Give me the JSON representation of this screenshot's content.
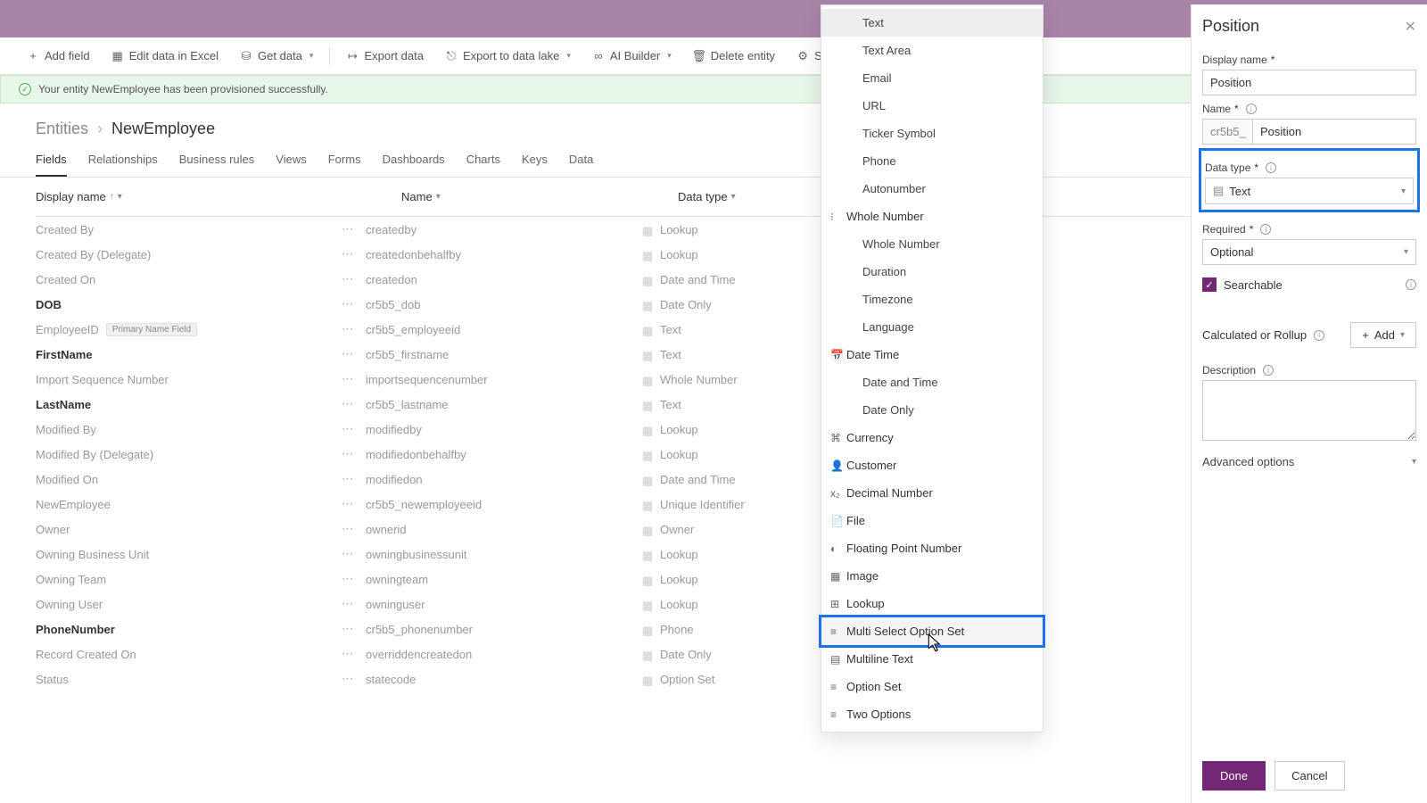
{
  "toolbar": {
    "add_field": "Add field",
    "edit_excel": "Edit data in Excel",
    "get_data": "Get data",
    "export_data": "Export data",
    "export_lake": "Export to data lake",
    "ai_builder": "AI Builder",
    "delete_entity": "Delete entity",
    "settings": "Settings"
  },
  "success_msg": "Your entity NewEmployee has been provisioned successfully.",
  "breadcrumb": {
    "parent": "Entities",
    "current": "NewEmployee"
  },
  "tabs": [
    "Fields",
    "Relationships",
    "Business rules",
    "Views",
    "Forms",
    "Dashboards",
    "Charts",
    "Keys",
    "Data"
  ],
  "columns": {
    "display": "Display name",
    "name": "Name",
    "type": "Data type"
  },
  "rows": [
    {
      "display": "Created By",
      "name": "createdby",
      "type": "Lookup",
      "bold": false
    },
    {
      "display": "Created By (Delegate)",
      "name": "createdonbehalfby",
      "type": "Lookup",
      "bold": false
    },
    {
      "display": "Created On",
      "name": "createdon",
      "type": "Date and Time",
      "bold": false
    },
    {
      "display": "DOB",
      "name": "cr5b5_dob",
      "type": "Date Only",
      "bold": true
    },
    {
      "display": "EmployeeID",
      "name": "cr5b5_employeeid",
      "type": "Text",
      "bold": false,
      "badge": "Primary Name Field"
    },
    {
      "display": "FirstName",
      "name": "cr5b5_firstname",
      "type": "Text",
      "bold": true
    },
    {
      "display": "Import Sequence Number",
      "name": "importsequencenumber",
      "type": "Whole Number",
      "bold": false
    },
    {
      "display": "LastName",
      "name": "cr5b5_lastname",
      "type": "Text",
      "bold": true
    },
    {
      "display": "Modified By",
      "name": "modifiedby",
      "type": "Lookup",
      "bold": false
    },
    {
      "display": "Modified By (Delegate)",
      "name": "modifiedonbehalfby",
      "type": "Lookup",
      "bold": false
    },
    {
      "display": "Modified On",
      "name": "modifiedon",
      "type": "Date and Time",
      "bold": false
    },
    {
      "display": "NewEmployee",
      "name": "cr5b5_newemployeeid",
      "type": "Unique Identifier",
      "bold": false
    },
    {
      "display": "Owner",
      "name": "ownerid",
      "type": "Owner",
      "bold": false
    },
    {
      "display": "Owning Business Unit",
      "name": "owningbusinessunit",
      "type": "Lookup",
      "bold": false
    },
    {
      "display": "Owning Team",
      "name": "owningteam",
      "type": "Lookup",
      "bold": false
    },
    {
      "display": "Owning User",
      "name": "owninguser",
      "type": "Lookup",
      "bold": false
    },
    {
      "display": "PhoneNumber",
      "name": "cr5b5_phonenumber",
      "type": "Phone",
      "bold": true
    },
    {
      "display": "Record Created On",
      "name": "overriddencreatedon",
      "type": "Date Only",
      "bold": false
    },
    {
      "display": "Status",
      "name": "statecode",
      "type": "Option Set",
      "bold": false
    }
  ],
  "dropdown": {
    "text_items": [
      "Text",
      "Text Area",
      "Email",
      "URL",
      "Ticker Symbol",
      "Phone",
      "Autonumber"
    ],
    "groups": [
      {
        "label": "Whole Number",
        "icon": "123",
        "items": [
          "Whole Number",
          "Duration",
          "Timezone",
          "Language"
        ]
      },
      {
        "label": "Date Time",
        "icon": "cal",
        "items": [
          "Date and Time",
          "Date Only"
        ]
      }
    ],
    "simple": [
      {
        "label": "Currency",
        "icon": "cur"
      },
      {
        "label": "Customer",
        "icon": "cust"
      },
      {
        "label": "Decimal Number",
        "icon": "dec"
      },
      {
        "label": "File",
        "icon": "file"
      },
      {
        "label": "Floating Point Number",
        "icon": "float"
      },
      {
        "label": "Image",
        "icon": "img"
      },
      {
        "label": "Lookup",
        "icon": "look"
      },
      {
        "label": "Multi Select Option Set",
        "icon": "multi",
        "highlight": true
      },
      {
        "label": "Multiline Text",
        "icon": "mtext"
      },
      {
        "label": "Option Set",
        "icon": "opt"
      },
      {
        "label": "Two Options",
        "icon": "two"
      }
    ]
  },
  "panel": {
    "title": "Position",
    "display_name_label": "Display name",
    "display_name_value": "Position",
    "name_label": "Name",
    "name_prefix": "cr5b5_",
    "name_value": "Position",
    "datatype_label": "Data type",
    "datatype_value": "Text",
    "required_label": "Required",
    "required_value": "Optional",
    "searchable": "Searchable",
    "calc_label": "Calculated or Rollup",
    "add_label": "Add",
    "desc_label": "Description",
    "advanced": "Advanced options",
    "done": "Done",
    "cancel": "Cancel"
  }
}
